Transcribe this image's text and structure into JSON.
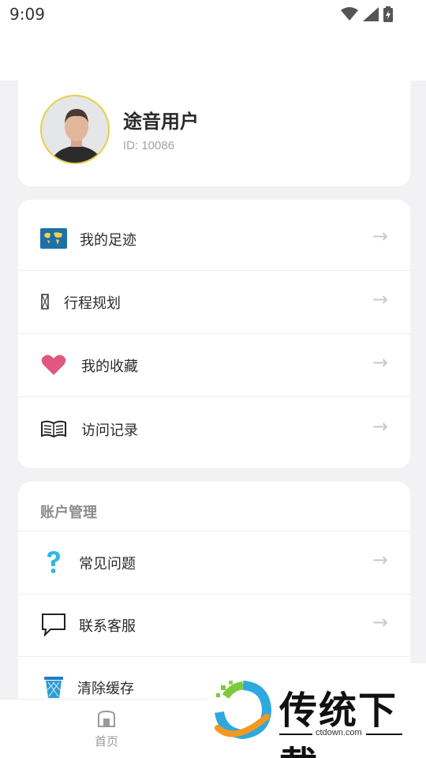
{
  "status_bar": {
    "time": "9:09",
    "icons": [
      "wifi-icon",
      "signal-icon",
      "battery-charging-icon"
    ]
  },
  "profile": {
    "name": "途音用户",
    "id_text": "ID: 10086"
  },
  "menu": {
    "items": [
      {
        "icon": "world-map-icon",
        "label": "我的足迹",
        "arrow": "→"
      },
      {
        "icon": "missing-glyph-icon",
        "label": "行程规划",
        "arrow": "→"
      },
      {
        "icon": "heart-icon",
        "label": "我的收藏",
        "arrow": "→"
      },
      {
        "icon": "open-book-icon",
        "label": "访问记录",
        "arrow": "→"
      }
    ]
  },
  "account": {
    "title": "账户管理",
    "items": [
      {
        "icon": "question-icon",
        "label": "常见问题",
        "arrow": "→"
      },
      {
        "icon": "speech-bubble-icon",
        "label": "联系客服",
        "arrow": "→"
      },
      {
        "icon": "trash-can-icon",
        "label": "清除缓存"
      }
    ]
  },
  "tabbar": {
    "items": [
      {
        "icon": "home-icon",
        "label": "首页"
      }
    ]
  },
  "watermark": {
    "text": "传统下载",
    "url": "ctdown.com"
  },
  "colors": {
    "accent_heart": "#e0577f",
    "question": "#2eb8e6",
    "avatar_ring": "#e8cf45"
  }
}
